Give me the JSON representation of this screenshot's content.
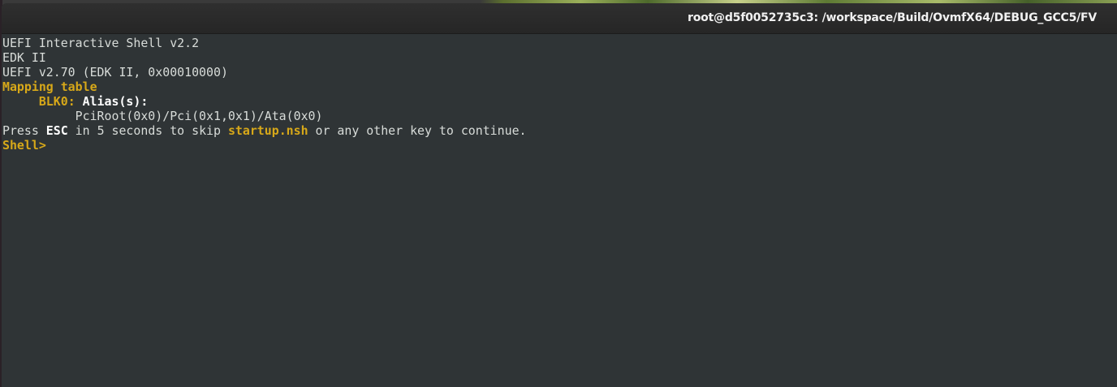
{
  "window": {
    "title": "root@d5f0052735c3: /workspace/Build/OvmfX64/DEBUG_GCC5/FV"
  },
  "terminal": {
    "line1": "UEFI Interactive Shell v2.2",
    "line2": "EDK II",
    "line3": "UEFI v2.70 (EDK II, 0x00010000)",
    "line4": "Mapping table",
    "blk_indent": "     ",
    "blk_name": "BLK0:",
    "alias_label": " Alias(s):",
    "device_path_indent": "          ",
    "device_path": "PciRoot(0x0)/Pci(0x1,0x1)/Ata(0x0)",
    "press_prefix": "Press ",
    "esc_key": "ESC",
    "press_middle": " in 5 seconds to skip ",
    "startup_script": "startup.nsh",
    "press_suffix": " or any other key to continue.",
    "prompt": "Shell>"
  },
  "colors": {
    "background": "#2f3436",
    "text": "#d8dcd9",
    "highlight": "#d7a819",
    "titlebar": "#2b2b2b"
  }
}
